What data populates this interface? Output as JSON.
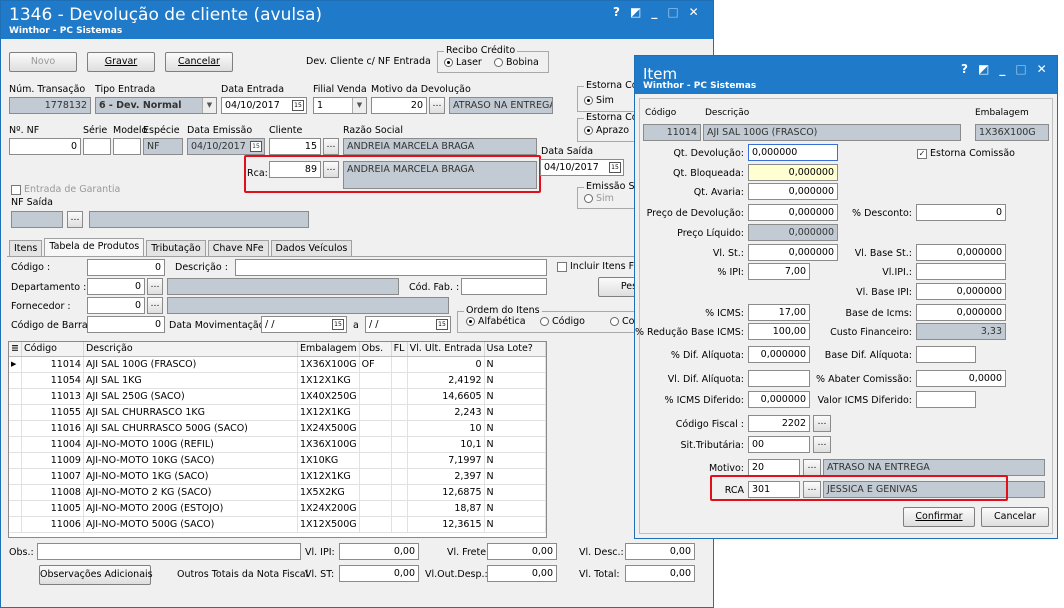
{
  "main": {
    "title": "1346 - Devolução de cliente (avulsa)",
    "subtitle": "Winthor - PC Sistemas",
    "window_controls": [
      "?",
      "◩",
      "_",
      "□",
      "✕"
    ],
    "toolbar": {
      "novo": "Novo",
      "gravar": "Gravar",
      "cancelar": "Cancelar",
      "dev_cliente_label": "Dev. Cliente c/ NF Entrada"
    },
    "recibo": {
      "title": "Recibo Crédito",
      "opt1": "Laser",
      "opt2": "Bobina"
    },
    "row1": {
      "num_transacao_label": "Núm. Transação",
      "num_transacao": "1778132",
      "tipo_entrada_label": "Tipo Entrada",
      "tipo_entrada": "6 - Dev. Normal",
      "data_entrada_label": "Data Entrada",
      "data_entrada": "04/10/2017",
      "filial_venda_label": "Filial Venda",
      "filial_venda": "1",
      "motivo_label": "Motivo da Devolução",
      "motivo_code": "20",
      "motivo_desc": "ATRASO NA ENTREGA",
      "estorna_com_label": "Estorna Com",
      "estorna_com_opt": "Sim"
    },
    "row2": {
      "nf_label": "Nº. NF",
      "nf": "0",
      "serie_label": "Série",
      "modelo_label": "Modelo",
      "especie_label": "Espécie",
      "especie": "NF",
      "data_emissao_label": "Data Emissão",
      "data_emissao": "04/10/2017",
      "cliente_label": "Cliente",
      "cliente": "15",
      "razao_label": "Razão Social",
      "razao": "ANDREIA MARCELA BRAGA",
      "estorna_com2_label": "Estorna Com",
      "estorna_com2_opt": "Aprazo"
    },
    "rca": {
      "label": "Rca:",
      "code": "89",
      "name": "ANDREIA MARCELA BRAGA"
    },
    "data_saida": {
      "label": "Data Saída",
      "value": "04/10/2017"
    },
    "emissao_sef": {
      "label": "Emissão SEF",
      "opt": "Sim"
    },
    "entrada_garantia": "Entrada de Garantia",
    "nf_saida": "NF Saída",
    "tabs": [
      "Itens",
      "Tabela de Produtos",
      "Tributação",
      "Chave NFe",
      "Dados Veículos"
    ],
    "filters": {
      "codigo_label": "Código :",
      "codigo": "0",
      "descricao_label": "Descrição :",
      "incluir_label": "Incluir Itens Fo",
      "departamento_label": "Departamento :",
      "departamento": "0",
      "cod_fab_label": "Cód. Fab. :",
      "pesquisar": "Pes",
      "fornecedor_label": "Fornecedor :",
      "fornecedor": "0",
      "ordem_title": "Ordem do Itens",
      "ordem_opt1": "Alfabética",
      "ordem_opt2": "Código",
      "ordem_opt3": "Co",
      "cod_barra_label": "Código de Barra:",
      "cod_barra": "0",
      "data_mov_label": "Data Movimentação:",
      "data_mov_from": " / /",
      "data_mov_a": "a",
      "data_mov_to": " / /"
    },
    "grid": {
      "columns": [
        "Código",
        "Descrição",
        "Embalagem",
        "Obs.",
        "FL",
        "Vl. Ult. Entrada",
        "Usa Lote?"
      ],
      "rows": [
        [
          "11014",
          "AJI SAL 100G (FRASCO)",
          "1X36X100G",
          "OF",
          "",
          "0",
          "N"
        ],
        [
          "11054",
          "AJI SAL 1KG",
          "1X12X1KG",
          "",
          "",
          "2,4192",
          "N"
        ],
        [
          "11013",
          "AJI SAL 250G (SACO)",
          "1X40X250G",
          "",
          "",
          "14,6605",
          "N"
        ],
        [
          "11055",
          "AJI SAL CHURRASCO 1KG",
          "1X12X1KG",
          "",
          "",
          "2,243",
          "N"
        ],
        [
          "11016",
          "AJI SAL CHURRASCO 500G (SACO)",
          "1X24X500G",
          "",
          "",
          "10",
          "N"
        ],
        [
          "11004",
          "AJI-NO-MOTO 100G (REFIL)",
          "1X36X100G",
          "",
          "",
          "10,1",
          "N"
        ],
        [
          "11009",
          "AJI-NO-MOTO 10KG (SACO)",
          "1X10KG",
          "",
          "",
          "7,1997",
          "N"
        ],
        [
          "11007",
          "AJI-NO-MOTO 1KG (SACO)",
          "1X12X1KG",
          "",
          "",
          "2,397",
          "N"
        ],
        [
          "11008",
          "AJI-NO-MOTO 2 KG (SACO)",
          "1X5X2KG",
          "",
          "",
          "12,6875",
          "N"
        ],
        [
          "11005",
          "AJI-NO-MOTO 200G (ESTOJO)",
          "1X24X200G",
          "",
          "",
          "18,87",
          "N"
        ],
        [
          "11006",
          "AJI-NO-MOTO 500G (SACO)",
          "1X12X500G",
          "",
          "",
          "12,3615",
          "N"
        ]
      ]
    },
    "footer": {
      "obs_label": "Obs.:",
      "obs_btn": "Observações Adicionais",
      "outros_label": "Outros Totais da Nota Fiscal",
      "vl_ipi_label": "Vl. IPI:",
      "vl_ipi": "0,00",
      "vl_st_label": "Vl. ST:",
      "vl_st": "0,00",
      "vl_frete_label": "Vl. Frete:",
      "vl_frete": "0,00",
      "vl_out_label": "Vl.Out.Desp.:",
      "vl_out": "0,00",
      "vl_desc_label": "Vl. Desc.:",
      "vl_desc": "0,00",
      "vl_total_label": "Vl. Total:",
      "vl_total": "0,00"
    }
  },
  "dialog": {
    "title": "Item",
    "subtitle": "Winthor - PC Sistemas",
    "hdr_codigo": "Código",
    "hdr_descricao": "Descrição",
    "hdr_embalagem": "Embalagem",
    "codigo": "11014",
    "descricao": "AJI SAL 100G (FRASCO)",
    "embalagem": "1X36X100G",
    "qt_devolucao_label": "Qt. Devolução:",
    "qt_devolucao": "0,000000",
    "estorna_comissao": "Estorna Comissão",
    "qt_bloqueada_label": "Qt. Bloqueada:",
    "qt_bloqueada": "0,000000",
    "qt_avaria_label": "Qt. Avaria:",
    "qt_avaria": "0,000000",
    "preco_dev_label": "Preço de Devolução:",
    "preco_dev": "0,000000",
    "desconto_label": "% Desconto:",
    "desconto": "0",
    "preco_liq_label": "Preço Líquido:",
    "preco_liq": "0,000000",
    "vl_st_label": "Vl. St.:",
    "vl_st": "0,000000",
    "vl_base_st_label": "Vl. Base St.:",
    "vl_base_st": "0,000000",
    "pct_ipi_label": "% IPI:",
    "pct_ipi": "7,00",
    "vl_ipi_label": "Vl.IPI.:",
    "vl_ipi": "",
    "vl_base_ipi_label": "Vl. Base IPI:",
    "vl_base_ipi": "0,000000",
    "pct_icms_label": "% ICMS:",
    "pct_icms": "17,00",
    "base_icms_label": "Base de Icms:",
    "base_icms": "0,000000",
    "reducao_label": "% Redução Base ICMS:",
    "reducao": "100,00",
    "custo_fin_label": "Custo Financeiro:",
    "custo_fin": "3,33",
    "dif_aliq_label": "% Dif. Alíquota:",
    "dif_aliq": "0,000000",
    "base_dif_label": "Base Dif. Alíquota:",
    "base_dif": "",
    "vl_dif_label": "Vl. Dif. Alíquota:",
    "vl_dif": "",
    "abater_label": "% Abater Comissão:",
    "abater": "0,0000",
    "icms_dif_label": "% ICMS Diferido:",
    "icms_dif": "0,000000",
    "vl_icms_dif_label": "Valor ICMS Diferido:",
    "vl_icms_dif": "",
    "cod_fiscal_label": "Código Fiscal :",
    "cod_fiscal": "2202",
    "sit_trib_label": "Sit.Tributária:",
    "sit_trib": "00",
    "motivo_label": "Motivo:",
    "motivo_code": "20",
    "motivo_desc": "ATRASO NA ENTREGA",
    "rca_label": "RCA",
    "rca_code": "301",
    "rca_desc": "JESSICA E GENIVAS",
    "confirmar": "Confirmar",
    "cancelar": "Cancelar"
  },
  "colors": {
    "titlebar": "#1f7ac9",
    "highlight": "#e0101a",
    "readonly": "#c2cbd3",
    "required": "#ffffd2"
  }
}
